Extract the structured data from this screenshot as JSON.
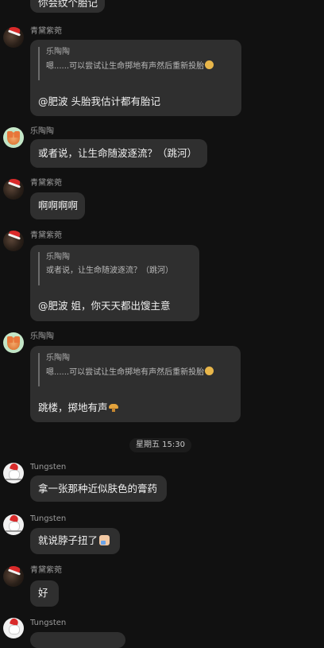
{
  "messages": [
    {
      "id": "m0",
      "sender": "",
      "text": "你会纹个胎记"
    },
    {
      "id": "m1",
      "sender": "青黛紫菀",
      "quote": {
        "sender": "乐陶陶",
        "text": "嗯......可以尝试让生命掷地有声然后重新投胎"
      },
      "text": "@肥波 头胎我估计都有胎记"
    },
    {
      "id": "m2",
      "sender": "乐陶陶",
      "text": "或者说，让生命随波逐流？（跳河）"
    },
    {
      "id": "m3",
      "sender": "青黛紫菀",
      "text": "啊啊啊啊"
    },
    {
      "id": "m4",
      "sender": "青黛紫菀",
      "quote": {
        "sender": "乐陶陶",
        "text": "或者说，让生命随波逐流？（跳河）"
      },
      "text": "@肥波 姐，你天天都出馊主意"
    },
    {
      "id": "m5",
      "sender": "乐陶陶",
      "quote": {
        "sender": "乐陶陶",
        "text": "嗯......可以尝试让生命掷地有声然后重新投胎"
      },
      "text": "跳楼，掷地有声"
    },
    {
      "id": "m6",
      "sender": "Tungsten",
      "text": "拿一张那种近似肤色的膏药"
    },
    {
      "id": "m7",
      "sender": "Tungsten",
      "text": "就说脖子扭了"
    },
    {
      "id": "m8",
      "sender": "青黛紫菀",
      "text": "好"
    },
    {
      "id": "m9",
      "sender": "Tungsten",
      "text": ""
    }
  ],
  "timestamp_divider": "星期五 15:30",
  "icons": {
    "face_emoji": "thinking-face-emoji",
    "thumb_emoji": "thumbs-up-emoji",
    "boom_emoji": "mushroom-cloud-emoji"
  },
  "colors": {
    "background": "#111111",
    "bubble": "#2f2f2f",
    "name_text": "#9b9b9b"
  }
}
